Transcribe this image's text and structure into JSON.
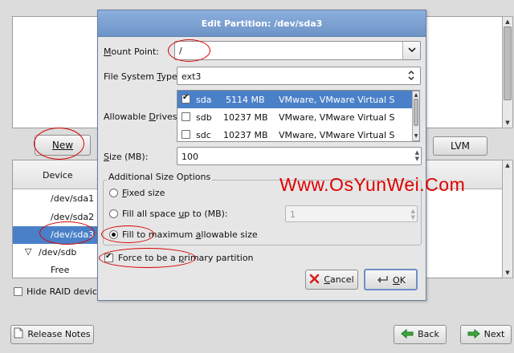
{
  "background": {
    "new_button": "New",
    "lvm_button": "LVM",
    "device_header": "Device",
    "devices": [
      {
        "label": "/dev/sda1",
        "selected": false,
        "indent": 1
      },
      {
        "label": "/dev/sda2",
        "selected": false,
        "indent": 1
      },
      {
        "label": "/dev/sda3",
        "selected": true,
        "indent": 1
      },
      {
        "label": "/dev/sdb",
        "selected": false,
        "indent": 0,
        "expander": "▽"
      },
      {
        "label": "Free",
        "selected": false,
        "indent": 1
      }
    ],
    "hide_raid_label": "Hide RAID device/",
    "release_notes_button": "Release Notes",
    "back_button": "Back",
    "next_button": "Next"
  },
  "dialog": {
    "title": "Edit Partition: /dev/sda3",
    "mount_point_label": "Mount Point:",
    "mount_point_value": "/",
    "fs_type_label": "File System Type:",
    "fs_type_value": "ext3",
    "allowable_drives_label": "Allowable Drives:",
    "drives": [
      {
        "name": "sda",
        "size": "5114 MB",
        "model": "VMware, VMware Virtual S",
        "checked": true,
        "selected": true
      },
      {
        "name": "sdb",
        "size": "10237 MB",
        "model": "VMware, VMware Virtual S",
        "checked": false,
        "selected": false
      },
      {
        "name": "sdc",
        "size": "10237 MB",
        "model": "VMware, VMware Virtual S",
        "checked": false,
        "selected": false
      }
    ],
    "size_label": "Size (MB):",
    "size_value": "100",
    "additional_size_title": "Additional Size Options",
    "fixed_size_label": "Fixed size",
    "fill_all_label": "Fill all space up to (MB):",
    "fill_all_value": "1",
    "fill_max_label": "Fill to maximum allowable size",
    "selected_size_option": "fill_max",
    "force_primary_label": "Force to be a primary partition",
    "force_primary_checked": true,
    "cancel_button": "Cancel",
    "ok_button": "OK"
  },
  "watermark": "Www.OsYunWei.Com",
  "colors": {
    "selection": "#4a80c8",
    "title_bar": "#7a9fd2",
    "annotation": "#d40000",
    "watermark": "#e00000"
  }
}
